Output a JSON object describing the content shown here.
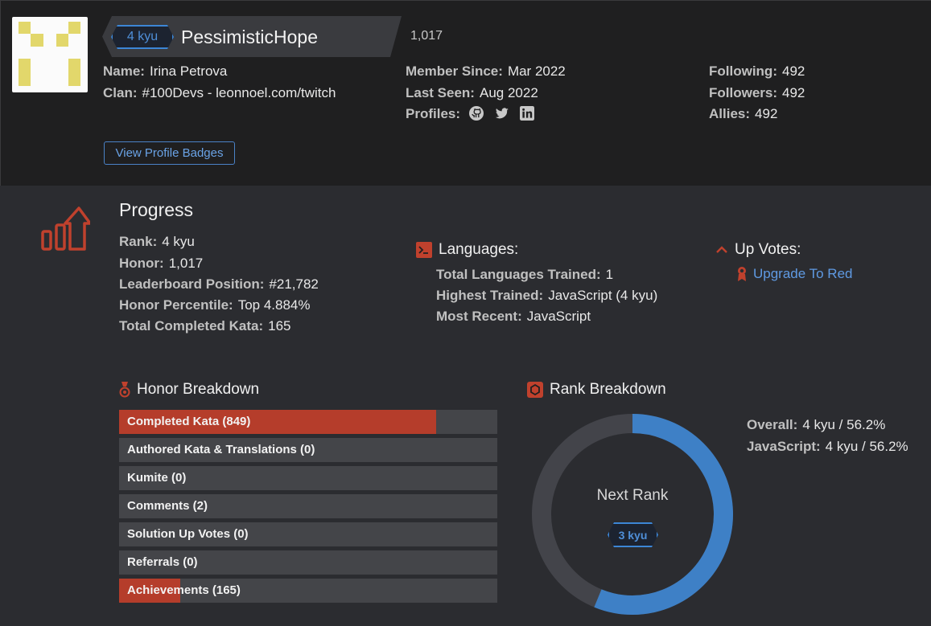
{
  "profile": {
    "username": "PessimisticHope",
    "rank": "4 kyu",
    "honor": "1,017",
    "name_label": "Name:",
    "name": "Irina Petrova",
    "clan_label": "Clan:",
    "clan": "#100Devs - leonnoel.com/twitch",
    "member_since_label": "Member Since:",
    "member_since": "Mar 2022",
    "last_seen_label": "Last Seen:",
    "last_seen": "Aug 2022",
    "profiles_label": "Profiles:",
    "profile_icons": [
      "github-icon",
      "twitter-icon",
      "linkedin-icon"
    ],
    "following_label": "Following:",
    "following": "492",
    "followers_label": "Followers:",
    "followers": "492",
    "allies_label": "Allies:",
    "allies": "492",
    "badges_button": "View Profile Badges"
  },
  "progress": {
    "title": "Progress",
    "rank_label": "Rank:",
    "rank": "4 kyu",
    "honor_label": "Honor:",
    "honor": "1,017",
    "leaderboard_label": "Leaderboard Position:",
    "leaderboard": "#21,782",
    "percentile_label": "Honor Percentile:",
    "percentile": "Top 4.884%",
    "completed_label": "Total Completed Kata:",
    "completed": "165"
  },
  "languages": {
    "title": "Languages:",
    "trained_label": "Total Languages Trained:",
    "trained": "1",
    "highest_label": "Highest Trained:",
    "highest": "JavaScript (4 kyu)",
    "recent_label": "Most Recent:",
    "recent": "JavaScript"
  },
  "upvotes": {
    "title": "Up Votes:",
    "link": "Upgrade To Red"
  },
  "honor_breakdown": {
    "title": "Honor Breakdown",
    "items": [
      {
        "label": "Completed Kata (849)",
        "fraction": 0.838
      },
      {
        "label": "Authored Kata & Translations (0)",
        "fraction": 0
      },
      {
        "label": "Kumite (0)",
        "fraction": 0
      },
      {
        "label": "Comments (2)",
        "fraction": 0
      },
      {
        "label": "Solution Up Votes (0)",
        "fraction": 0
      },
      {
        "label": "Referrals (0)",
        "fraction": 0
      },
      {
        "label": "Achievements (165)",
        "fraction": 0.162
      }
    ]
  },
  "rank_breakdown": {
    "title": "Rank Breakdown",
    "progress_fraction": 0.562,
    "next_rank_label": "Next Rank",
    "next_rank": "3 kyu",
    "overall_label": "Overall:",
    "overall": "4 kyu / 56.2%",
    "javascript_label": "JavaScript:",
    "javascript": "4 kyu / 56.2%"
  },
  "colors": {
    "accent_red": "#b53d2b",
    "accent_blue": "#3c86d6",
    "link_blue": "#5f9ae3"
  }
}
